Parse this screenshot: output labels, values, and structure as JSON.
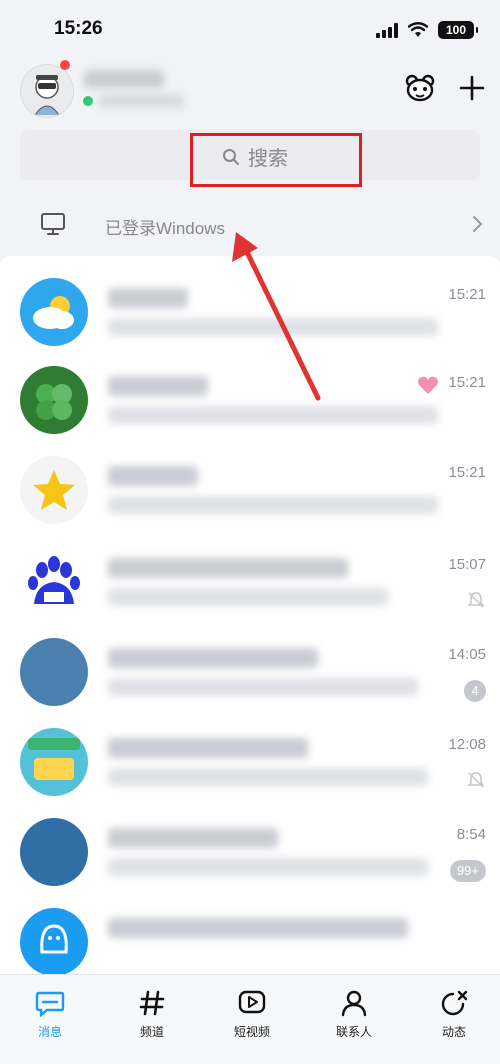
{
  "status_bar": {
    "time": "15:26",
    "battery": "100"
  },
  "search": {
    "placeholder": "搜索"
  },
  "device": {
    "label": "已登录Windows"
  },
  "chats": [
    {
      "time": "15:21"
    },
    {
      "time": "15:21"
    },
    {
      "time": "15:21"
    },
    {
      "time": "15:07"
    },
    {
      "time": "14:05",
      "badge": "4"
    },
    {
      "time": "12:08"
    },
    {
      "time": "8:54",
      "badge": "99+"
    },
    {
      "time": ""
    }
  ],
  "tabs": [
    {
      "label": "消息"
    },
    {
      "label": "频道"
    },
    {
      "label": "短视频"
    },
    {
      "label": "联系人"
    },
    {
      "label": "动态"
    }
  ],
  "colors": {
    "accent": "#1a9cf0",
    "highlight": "#e02020",
    "online": "#2ecc71"
  }
}
